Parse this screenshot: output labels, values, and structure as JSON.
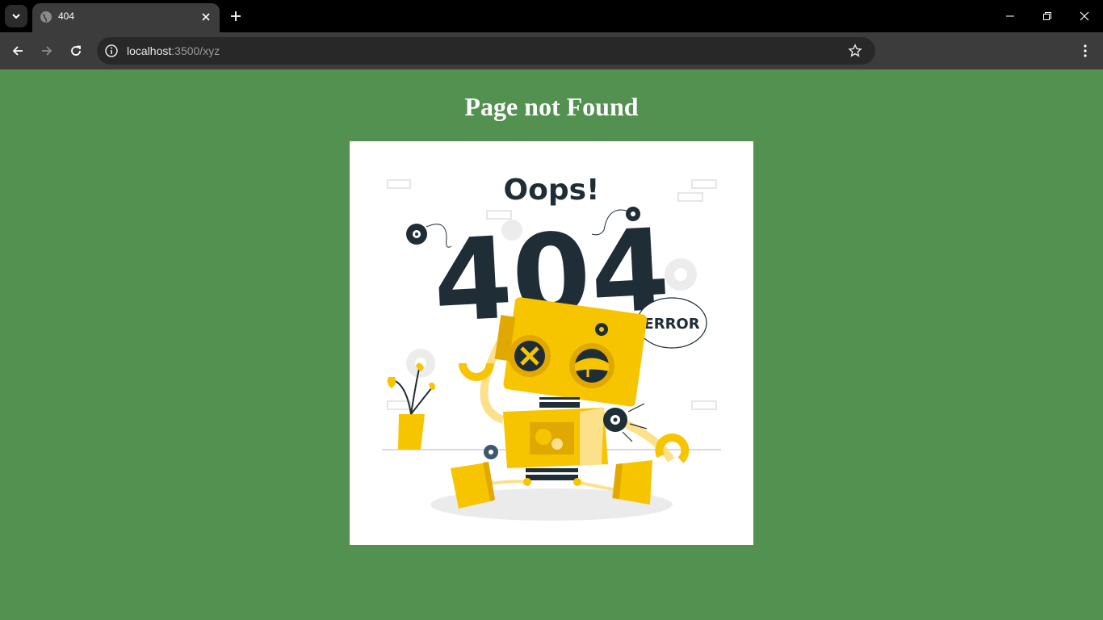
{
  "browser": {
    "tab_title": "404",
    "url_host": "localhost",
    "url_path": ":3500/xyz"
  },
  "page": {
    "heading": "Page not Found",
    "illustration": {
      "headline": "Oops!",
      "code": "404",
      "bubble": "ERROR"
    }
  },
  "colors": {
    "page_background": "#529150",
    "robot_yellow": "#f7c500",
    "dark_navy": "#1f2d37"
  }
}
